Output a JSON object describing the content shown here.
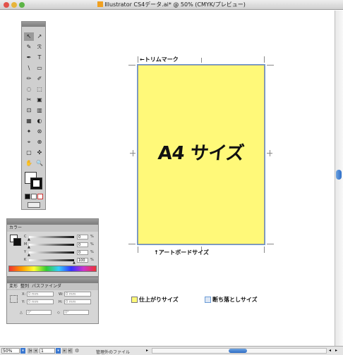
{
  "window": {
    "title": "Illustrator CS4データ.ai* @ 50% (CMYK/プレビュー)"
  },
  "artboard": {
    "main_text": "A4 サイズ",
    "trim_label": "←トリムマーク",
    "artboard_label": "↑アートボードサイズ",
    "legend_finish": "仕上がりサイズ",
    "legend_bleed": "断ち落としサイズ",
    "colors": {
      "artboard_fill": "#fff979",
      "bleed_line": "#6a9bd6"
    }
  },
  "color_panel": {
    "tab": "カラー",
    "channels": [
      {
        "label": "C",
        "value": "0"
      },
      {
        "label": "M",
        "value": "0"
      },
      {
        "label": "Y",
        "value": "0"
      },
      {
        "label": "K",
        "value": "100"
      }
    ],
    "percent": "%"
  },
  "transform_panel": {
    "tabs": [
      "変形",
      "整列",
      "パスファインダ"
    ],
    "x_label": "X:",
    "x_value": "0 mm",
    "y_label": "Y:",
    "y_value": "0 mm",
    "w_label": "W:",
    "w_value": "0 mm",
    "h_label": "H:",
    "h_value": "0 mm",
    "rotate": "0°",
    "shear": "0°"
  },
  "status_bar": {
    "zoom": "50%",
    "page": "1",
    "status_text": "管理外のファイル"
  },
  "tools": [
    "↖",
    "↗",
    "✎",
    "ℛ",
    "✒",
    "T",
    "\\",
    "▭",
    "✏",
    "✐",
    "◌",
    "⬚",
    "✂",
    "▣",
    "⊡",
    "▥",
    "▦",
    "◐",
    "✦",
    "⊛",
    "⌖",
    "⊕",
    "▢",
    "✜",
    "✋",
    "🔍"
  ]
}
